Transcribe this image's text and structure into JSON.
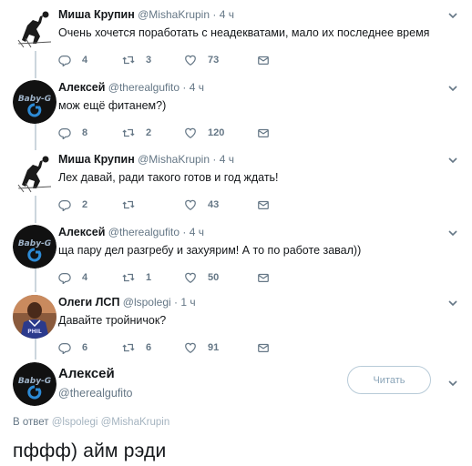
{
  "tweets": [
    {
      "name": "Миша Крупин",
      "handle": "@MishaKrupin",
      "dot": "·",
      "time": "4 ч",
      "text": "Очень хочется поработать с неадекватами, мало их последнее время",
      "replies": "4",
      "retweets": "3",
      "likes": "73",
      "avatar": "volleyball-player-avatar"
    },
    {
      "name": "Алексей",
      "handle": "@therealgufito",
      "dot": "·",
      "time": "4 ч",
      "text": "мож ещё фитанем?)",
      "replies": "8",
      "retweets": "2",
      "likes": "120",
      "avatar": "baby-g-logo-avatar"
    },
    {
      "name": "Миша Крупин",
      "handle": "@MishaKrupin",
      "dot": "·",
      "time": "4 ч",
      "text": "Лех давай, ради такого готов и год ждать!",
      "replies": "2",
      "retweets": "",
      "likes": "43",
      "avatar": "volleyball-player-avatar"
    },
    {
      "name": "Алексей",
      "handle": "@therealgufito",
      "dot": "·",
      "time": "4 ч",
      "text": "ща пару дел разгребу и захуярим! А то по работе завал))",
      "replies": "4",
      "retweets": "1",
      "likes": "50",
      "avatar": "baby-g-logo-avatar"
    },
    {
      "name": "Олеги ЛСП",
      "handle": "@lspolegi",
      "dot": "·",
      "time": "1 ч",
      "text": "Давайте тройничок?",
      "replies": "6",
      "retweets": "6",
      "likes": "91",
      "avatar": "basketball-player-avatar"
    }
  ],
  "main": {
    "name": "Алексей",
    "handle": "@therealgufito",
    "follow_label": "Читать",
    "reply_prefix": "В ответ",
    "reply_mentions": "@lspolegi @MishaKrupin",
    "text": "пффф) айм рэди"
  },
  "colors": {
    "text": "#14171a",
    "muted": "#657786",
    "thread_line": "#ccd6dd",
    "button_border": "#b8cbd8"
  }
}
